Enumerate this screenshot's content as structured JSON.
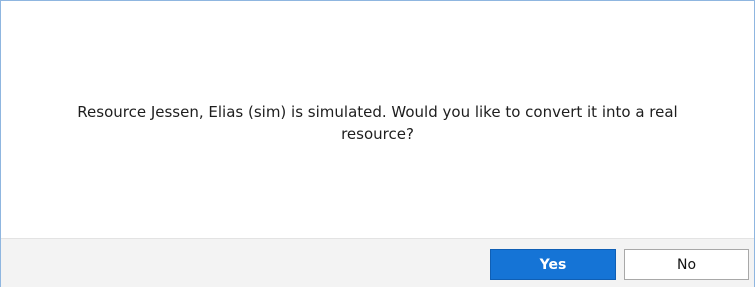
{
  "dialog": {
    "message_line1": "Resource Jessen, Elias (sim) is simulated. Would you like to convert it into a real",
    "message_line2": "resource?"
  },
  "buttons": {
    "yes_label": "Yes",
    "no_label": "No"
  },
  "colors": {
    "primary_button": "#1574d6",
    "footer_background": "#f3f3f3",
    "dialog_border": "#8fb6e0"
  }
}
